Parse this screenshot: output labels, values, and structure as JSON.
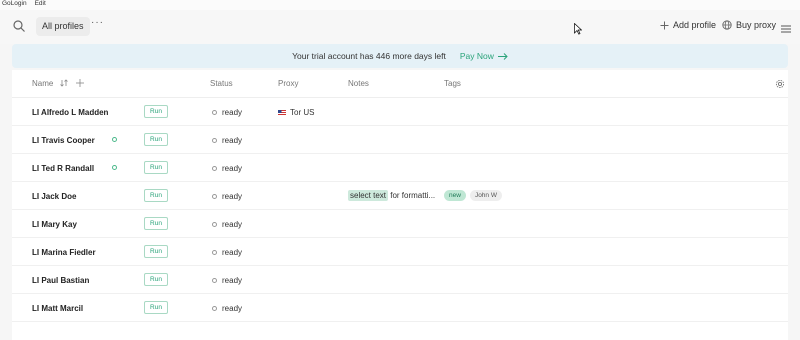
{
  "menubar": {
    "app": "GoLogin",
    "edit": "Edit"
  },
  "toolbar": {
    "folder": "All profiles",
    "more": "···",
    "add_profile": "Add profile",
    "buy_proxy": "Buy proxy"
  },
  "banner": {
    "text": "Your trial account has 446 more days left",
    "pay_now": "Pay Now"
  },
  "table": {
    "columns": {
      "name": "Name",
      "status": "Status",
      "proxy": "Proxy",
      "notes": "Notes",
      "tags": "Tags"
    },
    "rows": [
      {
        "name": "LI Alfredo L Madden",
        "synced": false,
        "run": "Run",
        "status": "ready",
        "proxy": "Tor US",
        "note_highlight": "",
        "note_rest": "",
        "tags": []
      },
      {
        "name": "LI Travis Cooper",
        "synced": true,
        "run": "Run",
        "status": "ready",
        "proxy": "",
        "note_highlight": "",
        "note_rest": "",
        "tags": []
      },
      {
        "name": "LI Ted R Randall",
        "synced": true,
        "run": "Run",
        "status": "ready",
        "proxy": "",
        "note_highlight": "",
        "note_rest": "",
        "tags": []
      },
      {
        "name": "LI Jack Doe",
        "synced": false,
        "run": "Run",
        "status": "ready",
        "proxy": "",
        "note_highlight": "select text",
        "note_rest": " for formatti...",
        "tags": [
          "new",
          "John W"
        ]
      },
      {
        "name": "LI Mary Kay",
        "synced": false,
        "run": "Run",
        "status": "ready",
        "proxy": "",
        "note_highlight": "",
        "note_rest": "",
        "tags": []
      },
      {
        "name": "LI Marina Fiedler",
        "synced": false,
        "run": "Run",
        "status": "ready",
        "proxy": "",
        "note_highlight": "",
        "note_rest": "",
        "tags": []
      },
      {
        "name": "LI Paul Bastian",
        "synced": false,
        "run": "Run",
        "status": "ready",
        "proxy": "",
        "note_highlight": "",
        "note_rest": "",
        "tags": []
      },
      {
        "name": "LI Matt Marcil",
        "synced": false,
        "run": "Run",
        "status": "ready",
        "proxy": "",
        "note_highlight": "",
        "note_rest": "",
        "tags": []
      }
    ]
  },
  "colors": {
    "accent": "#2aa37a",
    "banner_bg": "#e5f1f7",
    "tag_new_bg": "#bfe7d4"
  }
}
